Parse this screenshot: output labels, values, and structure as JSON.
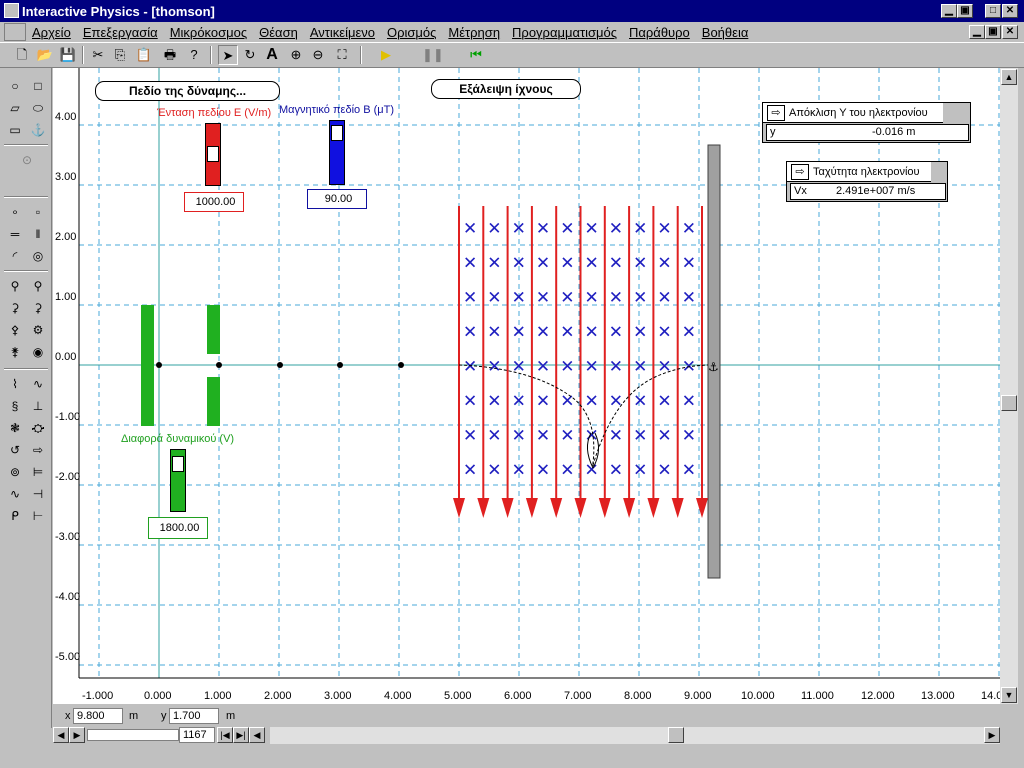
{
  "app": {
    "title": "Interactive Physics - [thomson]"
  },
  "menu": [
    "Αρχείο",
    "Επεξεργασία",
    "Μικρόκοσμος",
    "Θέαση",
    "Αντικείμενο",
    "Ορισμός",
    "Μέτρηση",
    "Προγραμματισμός",
    "Παράθυρο",
    "Βοήθεια"
  ],
  "buttons": {
    "field_button": "Πεδίο της δύναμης...",
    "erase_button": "Εξάλειψη ίχνους"
  },
  "sliders": {
    "e_field": {
      "label": "Ένταση πεδίου E (V/m)",
      "value": "1000.00",
      "color": "#e02020",
      "level": 0.5
    },
    "b_field": {
      "label": "Μαγνητικό πεδίο B (μT)",
      "value": "90.00",
      "color": "#1010e0",
      "level": 0.85
    },
    "voltage": {
      "label": "Διαφορά δυναμικού (V)",
      "value": "1800.00",
      "color": "#20b020",
      "level": 0.75
    }
  },
  "meters": {
    "y_meter": {
      "title": "Απόκλιση Υ του ηλεκτρονίου",
      "var": "y",
      "value": "-0.016 m"
    },
    "vx_meter": {
      "title": "Ταχύτητα ηλεκτρονίου",
      "var": "Vx",
      "value": "2.491e+007 m/s"
    }
  },
  "axes": {
    "y_ticks": [
      "4.00",
      "3.00",
      "2.00",
      "1.00",
      "0.00",
      "-1.00",
      "-2.00",
      "-3.00",
      "-4.00",
      "-5.00"
    ],
    "x_ticks": [
      "-1.000",
      "0.000",
      "1.000",
      "2.000",
      "3.000",
      "4.000",
      "5.000",
      "6.000",
      "7.000",
      "8.000",
      "9.000",
      "10.000",
      "11.000",
      "12.000",
      "13.000",
      "14.0"
    ]
  },
  "status": {
    "x_label": "x",
    "x_value": "9.800",
    "x_unit": "m",
    "y_label": "y",
    "y_value": "1.700",
    "y_unit": "m"
  },
  "frame": {
    "value": "1167"
  },
  "icons": [
    "app-icon",
    "new-icon",
    "open-icon",
    "save-icon",
    "cut-icon",
    "copy-icon",
    "paste-icon",
    "print-icon",
    "help-icon",
    "arrow-icon",
    "rotate-icon",
    "text-icon",
    "zoom-in-icon",
    "zoom-out-icon",
    "zoom-fit-icon",
    "run-icon",
    "pause-icon",
    "reset-icon"
  ]
}
